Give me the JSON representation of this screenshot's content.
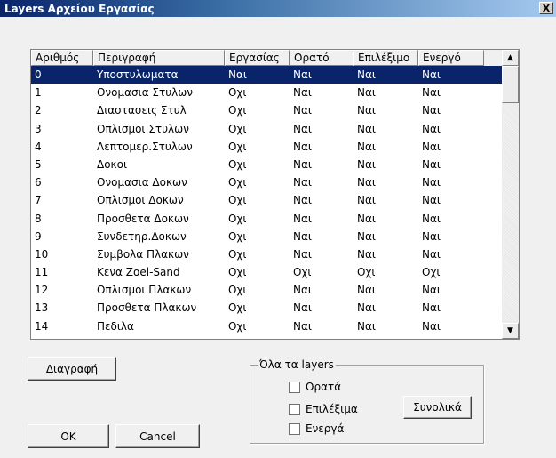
{
  "window": {
    "title": "Layers Αρχείου Εργασίας",
    "close_label": "X"
  },
  "table": {
    "columns": [
      "Αριθμός",
      "Περιγραφή",
      "Εργασίας",
      "Ορατό",
      "Επιλέξιμο",
      "Ενεργό"
    ],
    "selected_index": 0,
    "rows": [
      [
        "0",
        "Υποστυλωματα",
        "Ναι",
        "Ναι",
        "Ναι",
        "Ναι"
      ],
      [
        "1",
        "Ονομασια Στυλων",
        "Οχι",
        "Ναι",
        "Ναι",
        "Ναι"
      ],
      [
        "2",
        "Διαστασεις Στυλ",
        "Οχι",
        "Ναι",
        "Ναι",
        "Ναι"
      ],
      [
        "3",
        "Οπλισμοι Στυλων",
        "Οχι",
        "Ναι",
        "Ναι",
        "Ναι"
      ],
      [
        "4",
        "Λεπτομερ.Στυλων",
        "Οχι",
        "Ναι",
        "Ναι",
        "Ναι"
      ],
      [
        "5",
        "Δοκοι",
        "Οχι",
        "Ναι",
        "Ναι",
        "Ναι"
      ],
      [
        "6",
        "Ονομασια Δοκων",
        "Οχι",
        "Ναι",
        "Ναι",
        "Ναι"
      ],
      [
        "7",
        "Οπλισμοι Δοκων",
        "Οχι",
        "Ναι",
        "Ναι",
        "Ναι"
      ],
      [
        "8",
        "Προσθετα Δοκων",
        "Οχι",
        "Ναι",
        "Ναι",
        "Ναι"
      ],
      [
        "9",
        "Συνδετηρ.Δοκων",
        "Οχι",
        "Ναι",
        "Ναι",
        "Ναι"
      ],
      [
        "10",
        "Συμβολα Πλακων",
        "Οχι",
        "Ναι",
        "Ναι",
        "Ναι"
      ],
      [
        "11",
        "Κενα Zoel-Sand",
        "Οχι",
        "Οχι",
        "Οχι",
        "Οχι"
      ],
      [
        "12",
        "Οπλισμοι Πλακων",
        "Οχι",
        "Ναι",
        "Ναι",
        "Ναι"
      ],
      [
        "13",
        "Προσθετα Πλακων",
        "Οχι",
        "Ναι",
        "Ναι",
        "Ναι"
      ],
      [
        "14",
        "Πεδιλα",
        "Οχι",
        "Ναι",
        "Ναι",
        "Ναι"
      ]
    ]
  },
  "scrollbar": {
    "up_label": "▲",
    "down_label": "▼"
  },
  "buttons": {
    "delete_label": "Διαγραφή",
    "ok_label": "OK",
    "cancel_label": "Cancel",
    "total_label": "Συνολικά"
  },
  "all_layers_group": {
    "title": "Όλα τα layers",
    "visible_label": "Ορατά",
    "selectable_label": "Επιλέξιμα",
    "active_label": "Ενεργά"
  }
}
